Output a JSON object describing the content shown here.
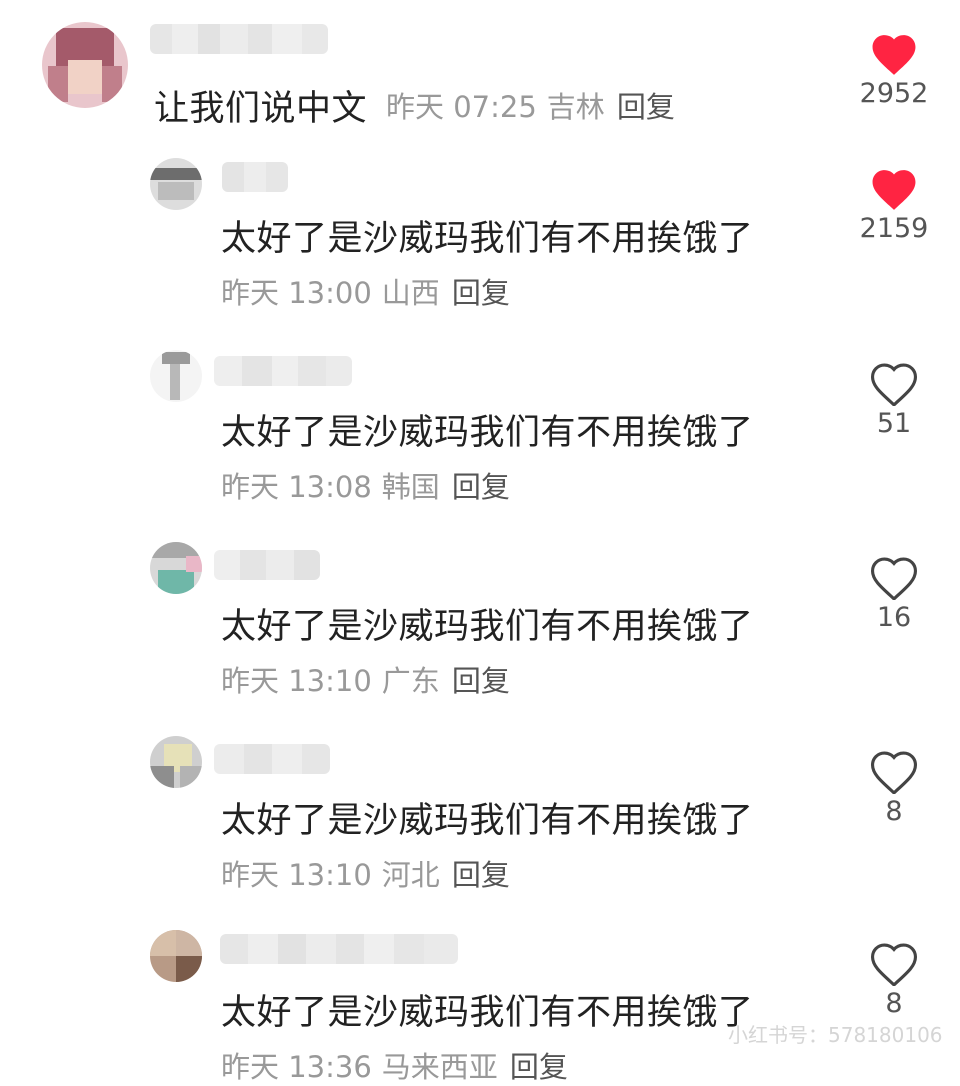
{
  "comments": [
    {
      "text": "让我们说中文",
      "date": "昨天 07:25",
      "location": "吉林",
      "reply": "回复",
      "likes": "2952",
      "liked": true
    },
    {
      "text": "太好了是沙威玛我们有不用挨饿了",
      "date": "昨天 13:00",
      "location": "山西",
      "reply": "回复",
      "likes": "2159",
      "liked": true
    },
    {
      "text": "太好了是沙威玛我们有不用挨饿了",
      "date": "昨天 13:08",
      "location": "韩国",
      "reply": "回复",
      "likes": "51",
      "liked": false
    },
    {
      "text": "太好了是沙威玛我们有不用挨饿了",
      "date": "昨天 13:10",
      "location": "广东",
      "reply": "回复",
      "likes": "16",
      "liked": false
    },
    {
      "text": "太好了是沙威玛我们有不用挨饿了",
      "date": "昨天 13:10",
      "location": "河北",
      "reply": "回复",
      "likes": "8",
      "liked": false
    },
    {
      "text": "太好了是沙威玛我们有不用挨饿了",
      "date": "昨天 13:36",
      "location": "马来西亚",
      "reply": "回复",
      "likes": "8",
      "liked": false
    }
  ],
  "watermark": "小红书号：578180106",
  "colors": {
    "liked": "#ff2442",
    "icon_outline": "#444444",
    "meta": "#999999",
    "text": "#222222"
  },
  "icons": {
    "liked": "heart-filled-icon",
    "unliked": "heart-outline-icon"
  }
}
